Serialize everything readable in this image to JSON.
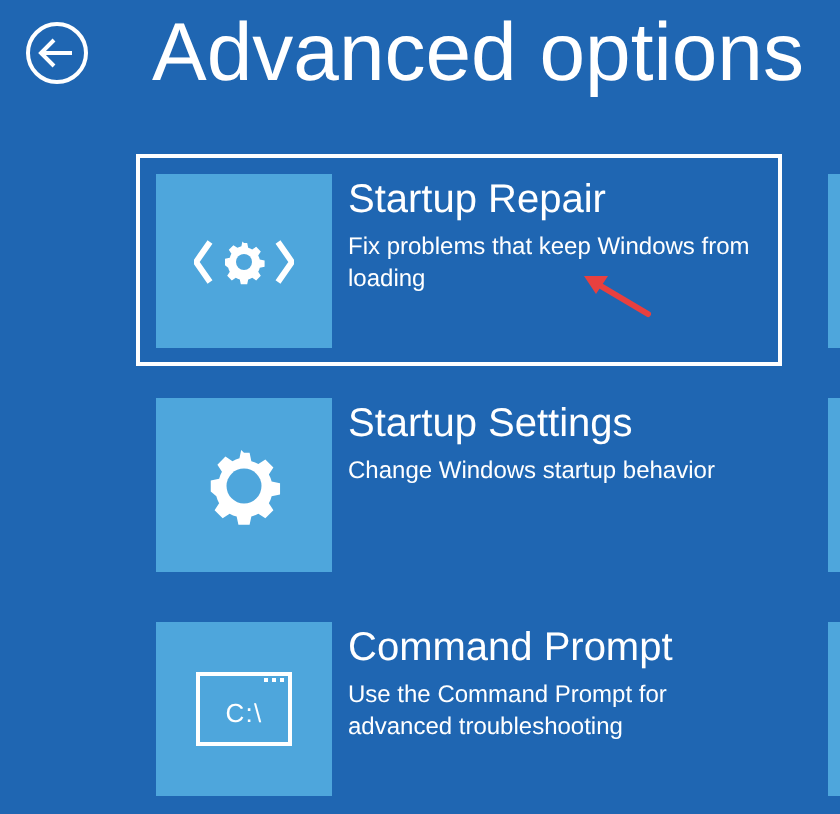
{
  "header": {
    "title": "Advanced options"
  },
  "options": [
    {
      "kind": "repair",
      "title": "Startup Repair",
      "description": "Fix problems that keep Windows from loading",
      "selected": true
    },
    {
      "kind": "gear",
      "title": "Startup Settings",
      "description": "Change Windows startup behavior",
      "selected": false
    },
    {
      "kind": "prompt",
      "title": "Command Prompt",
      "description": "Use the Command Prompt for advanced troubleshooting",
      "selected": false,
      "icon_text": "C:\\"
    }
  ],
  "annotation": {
    "kind": "arrow",
    "color": "#e8403f"
  }
}
